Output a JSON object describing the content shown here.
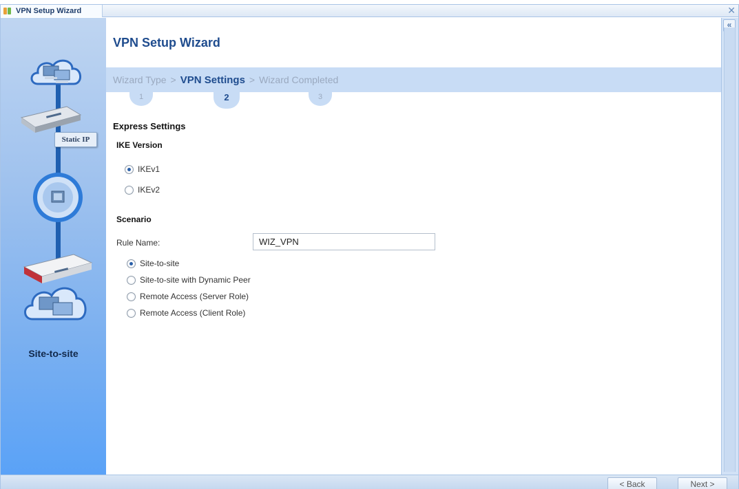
{
  "window": {
    "title": "VPN Setup Wizard",
    "close_glyph": "✕"
  },
  "rail": {
    "badge": "Static IP",
    "scenario_label": "Site-to-site"
  },
  "header": {
    "title": "VPN Setup Wizard"
  },
  "steps": [
    {
      "label": "Wizard Type",
      "number": "1",
      "state": "done"
    },
    {
      "label": "VPN Settings",
      "number": "2",
      "state": "active"
    },
    {
      "label": "Wizard Completed",
      "number": "3",
      "state": "pending"
    }
  ],
  "step_separator": ">",
  "form": {
    "express_title": "Express Settings",
    "ike_title": "IKE Version",
    "ike_options": [
      {
        "label": "IKEv1",
        "checked": true
      },
      {
        "label": "IKEv2",
        "checked": false
      }
    ],
    "scenario_title": "Scenario",
    "rule_name_label": "Rule Name:",
    "rule_name_value": "WIZ_VPN",
    "scenario_options": [
      {
        "label": "Site-to-site",
        "checked": true
      },
      {
        "label": "Site-to-site with Dynamic Peer",
        "checked": false
      },
      {
        "label": "Remote Access (Server Role)",
        "checked": false
      },
      {
        "label": "Remote Access (Client Role)",
        "checked": false
      }
    ]
  },
  "scrollbar": {
    "collapse_glyph": "«"
  },
  "footer": {
    "back_label": "< Back",
    "next_label": "Next >"
  },
  "colors": {
    "title_blue": "#1f4c8e",
    "step_bar": "#c8dcf5",
    "rail_top": "#bfd5f1",
    "rail_bottom": "#5aa2f7"
  }
}
